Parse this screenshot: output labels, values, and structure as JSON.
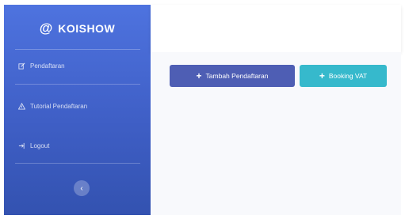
{
  "brand": {
    "at_symbol": "@",
    "name": "KOISHOW"
  },
  "sidebar": {
    "items": [
      {
        "label": "Pendaftaran",
        "icon": "edit-icon"
      },
      {
        "label": "Tutorial Pendaftaran",
        "icon": "warning-icon"
      },
      {
        "label": "Logout",
        "icon": "logout-icon"
      }
    ],
    "toggle_icon": "chevron-left-icon"
  },
  "actions": {
    "add_registration_label": "Tambah Pendaftaran",
    "booking_label": "Booking VAT"
  },
  "colors": {
    "sidebar": "#4e73df",
    "primary_button": "#4e5eb4",
    "info_button": "#36b9cc"
  }
}
